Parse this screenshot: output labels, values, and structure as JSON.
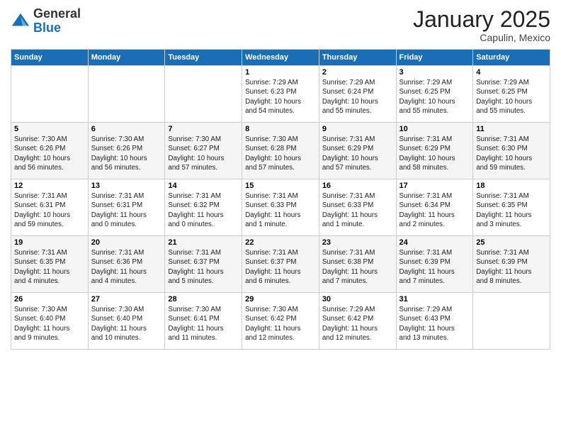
{
  "header": {
    "logo_general": "General",
    "logo_blue": "Blue",
    "month": "January 2025",
    "location": "Capulin, Mexico"
  },
  "days_of_week": [
    "Sunday",
    "Monday",
    "Tuesday",
    "Wednesday",
    "Thursday",
    "Friday",
    "Saturday"
  ],
  "weeks": [
    [
      {
        "day": "",
        "info": ""
      },
      {
        "day": "",
        "info": ""
      },
      {
        "day": "",
        "info": ""
      },
      {
        "day": "1",
        "info": "Sunrise: 7:29 AM\nSunset: 6:23 PM\nDaylight: 10 hours\nand 54 minutes."
      },
      {
        "day": "2",
        "info": "Sunrise: 7:29 AM\nSunset: 6:24 PM\nDaylight: 10 hours\nand 55 minutes."
      },
      {
        "day": "3",
        "info": "Sunrise: 7:29 AM\nSunset: 6:25 PM\nDaylight: 10 hours\nand 55 minutes."
      },
      {
        "day": "4",
        "info": "Sunrise: 7:29 AM\nSunset: 6:25 PM\nDaylight: 10 hours\nand 55 minutes."
      }
    ],
    [
      {
        "day": "5",
        "info": "Sunrise: 7:30 AM\nSunset: 6:26 PM\nDaylight: 10 hours\nand 56 minutes."
      },
      {
        "day": "6",
        "info": "Sunrise: 7:30 AM\nSunset: 6:26 PM\nDaylight: 10 hours\nand 56 minutes."
      },
      {
        "day": "7",
        "info": "Sunrise: 7:30 AM\nSunset: 6:27 PM\nDaylight: 10 hours\nand 57 minutes."
      },
      {
        "day": "8",
        "info": "Sunrise: 7:30 AM\nSunset: 6:28 PM\nDaylight: 10 hours\nand 57 minutes."
      },
      {
        "day": "9",
        "info": "Sunrise: 7:31 AM\nSunset: 6:29 PM\nDaylight: 10 hours\nand 57 minutes."
      },
      {
        "day": "10",
        "info": "Sunrise: 7:31 AM\nSunset: 6:29 PM\nDaylight: 10 hours\nand 58 minutes."
      },
      {
        "day": "11",
        "info": "Sunrise: 7:31 AM\nSunset: 6:30 PM\nDaylight: 10 hours\nand 59 minutes."
      }
    ],
    [
      {
        "day": "12",
        "info": "Sunrise: 7:31 AM\nSunset: 6:31 PM\nDaylight: 10 hours\nand 59 minutes."
      },
      {
        "day": "13",
        "info": "Sunrise: 7:31 AM\nSunset: 6:31 PM\nDaylight: 11 hours\nand 0 minutes."
      },
      {
        "day": "14",
        "info": "Sunrise: 7:31 AM\nSunset: 6:32 PM\nDaylight: 11 hours\nand 0 minutes."
      },
      {
        "day": "15",
        "info": "Sunrise: 7:31 AM\nSunset: 6:33 PM\nDaylight: 11 hours\nand 1 minute."
      },
      {
        "day": "16",
        "info": "Sunrise: 7:31 AM\nSunset: 6:33 PM\nDaylight: 11 hours\nand 1 minute."
      },
      {
        "day": "17",
        "info": "Sunrise: 7:31 AM\nSunset: 6:34 PM\nDaylight: 11 hours\nand 2 minutes."
      },
      {
        "day": "18",
        "info": "Sunrise: 7:31 AM\nSunset: 6:35 PM\nDaylight: 11 hours\nand 3 minutes."
      }
    ],
    [
      {
        "day": "19",
        "info": "Sunrise: 7:31 AM\nSunset: 6:35 PM\nDaylight: 11 hours\nand 4 minutes."
      },
      {
        "day": "20",
        "info": "Sunrise: 7:31 AM\nSunset: 6:36 PM\nDaylight: 11 hours\nand 4 minutes."
      },
      {
        "day": "21",
        "info": "Sunrise: 7:31 AM\nSunset: 6:37 PM\nDaylight: 11 hours\nand 5 minutes."
      },
      {
        "day": "22",
        "info": "Sunrise: 7:31 AM\nSunset: 6:37 PM\nDaylight: 11 hours\nand 6 minutes."
      },
      {
        "day": "23",
        "info": "Sunrise: 7:31 AM\nSunset: 6:38 PM\nDaylight: 11 hours\nand 7 minutes."
      },
      {
        "day": "24",
        "info": "Sunrise: 7:31 AM\nSunset: 6:39 PM\nDaylight: 11 hours\nand 7 minutes."
      },
      {
        "day": "25",
        "info": "Sunrise: 7:31 AM\nSunset: 6:39 PM\nDaylight: 11 hours\nand 8 minutes."
      }
    ],
    [
      {
        "day": "26",
        "info": "Sunrise: 7:30 AM\nSunset: 6:40 PM\nDaylight: 11 hours\nand 9 minutes."
      },
      {
        "day": "27",
        "info": "Sunrise: 7:30 AM\nSunset: 6:40 PM\nDaylight: 11 hours\nand 10 minutes."
      },
      {
        "day": "28",
        "info": "Sunrise: 7:30 AM\nSunset: 6:41 PM\nDaylight: 11 hours\nand 11 minutes."
      },
      {
        "day": "29",
        "info": "Sunrise: 7:30 AM\nSunset: 6:42 PM\nDaylight: 11 hours\nand 12 minutes."
      },
      {
        "day": "30",
        "info": "Sunrise: 7:29 AM\nSunset: 6:42 PM\nDaylight: 11 hours\nand 12 minutes."
      },
      {
        "day": "31",
        "info": "Sunrise: 7:29 AM\nSunset: 6:43 PM\nDaylight: 11 hours\nand 13 minutes."
      },
      {
        "day": "",
        "info": ""
      }
    ]
  ]
}
